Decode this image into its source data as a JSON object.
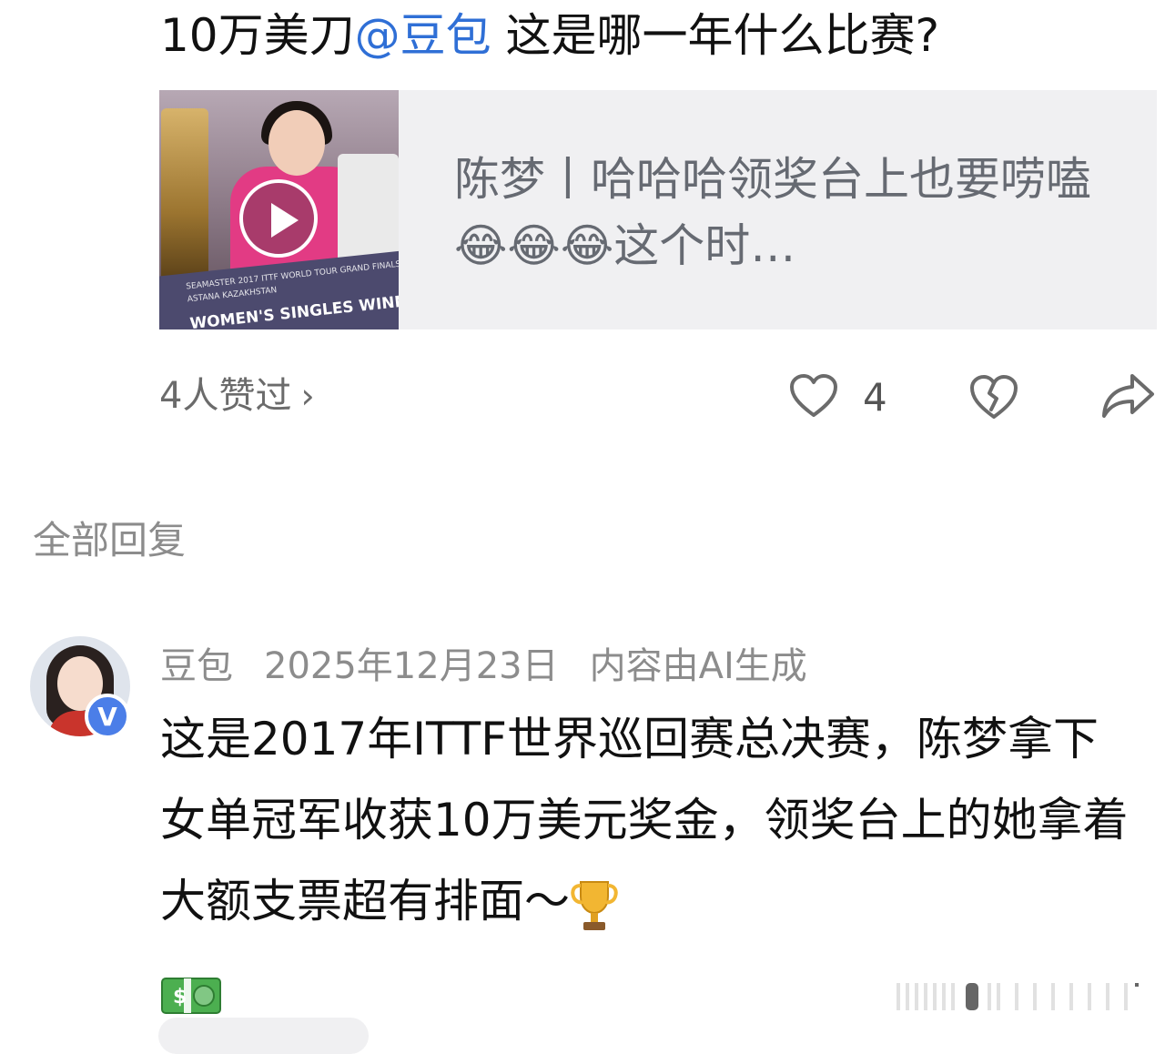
{
  "post": {
    "text_before": "10万美刀",
    "mention": "@豆包",
    "text_after": " 这是哪一年什么比赛?"
  },
  "link_card": {
    "title": "陈梦丨哈哈哈领奖台上也要唠嗑😂😂😂这个时…",
    "thumbnail": {
      "cheque_line1": "SEAMASTER 2017 ITTF WORLD TOUR GRAND FINALS",
      "cheque_line2": "ASTANA KAZAKHSTAN",
      "cheque_line3": "WOMEN'S SINGLES WINNER"
    }
  },
  "actions": {
    "likers_label": "4人赞过",
    "likers_chevron": "›",
    "like_count": "4",
    "like_icon": "heart-outline-icon",
    "dislike_icon": "broken-heart-icon",
    "share_icon": "share-arrow-icon"
  },
  "replies": {
    "section_title": "全部回复",
    "items": [
      {
        "author": "豆包",
        "date": "2025年12月23日",
        "note": "内容由AI生成",
        "badge": "V",
        "body": "这是2017年ITTF世界巡回赛总决赛，陈梦拿下女单冠军收获10万美元奖金，领奖台上的她拿着大额支票超有排面～",
        "emoji_1": "trophy-emoji",
        "emoji_2": "money-emoji"
      }
    ]
  },
  "colors": {
    "mention": "#2f6fd6",
    "muted_text": "#8c8c8c",
    "card_bg": "#f0f0f2",
    "verified": "#4b7ee8"
  }
}
